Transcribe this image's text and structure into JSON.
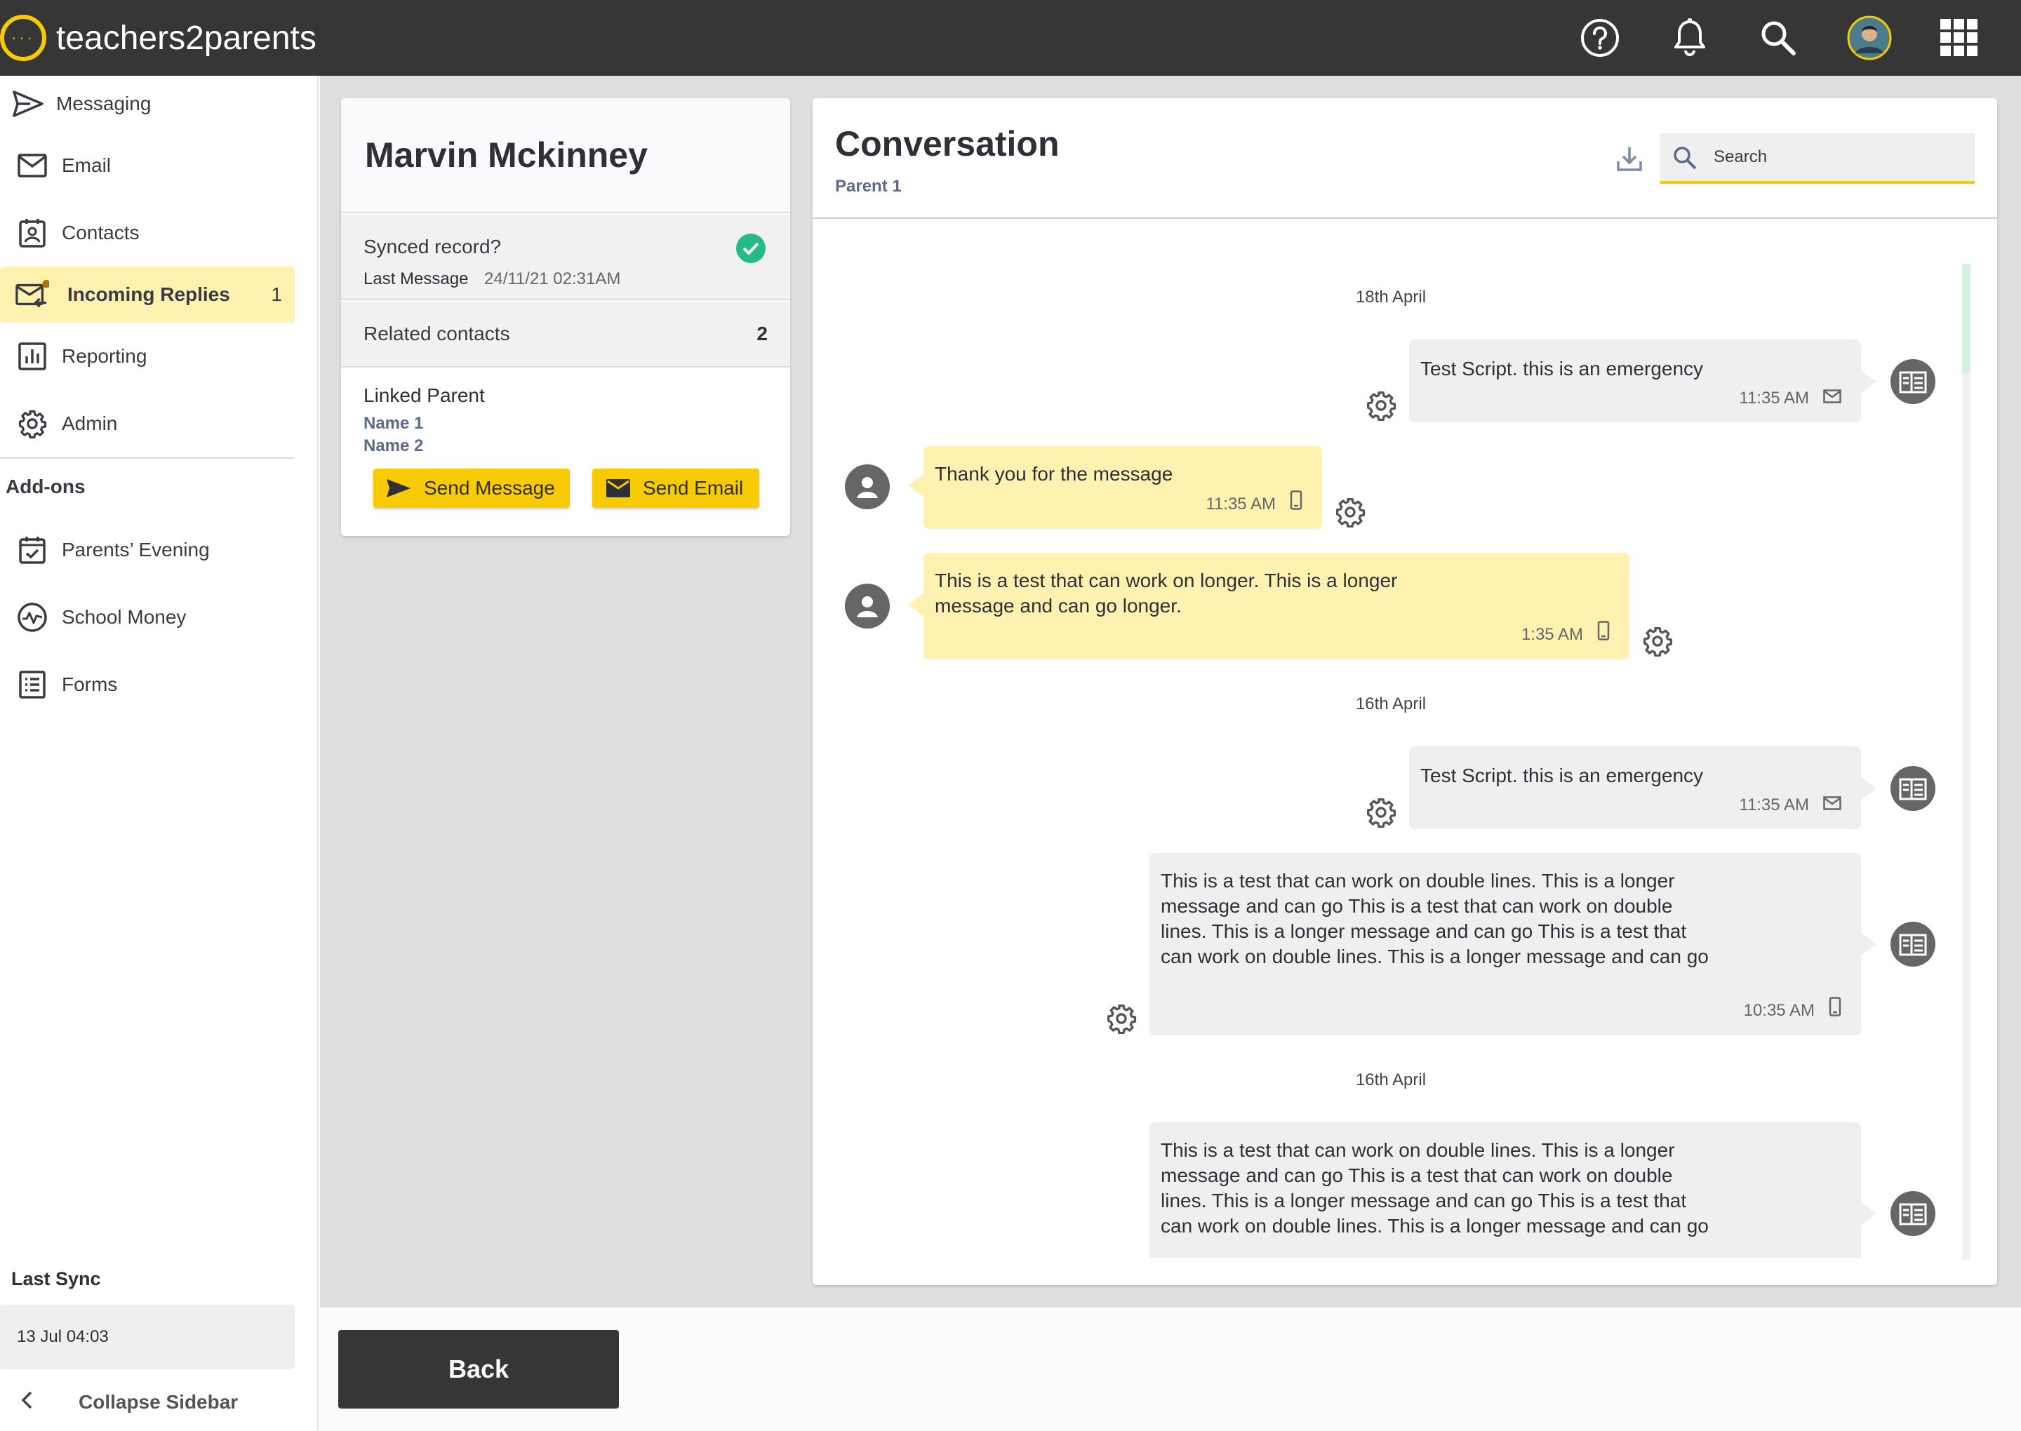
{
  "app": {
    "title": "teachers2parents"
  },
  "sidebar": {
    "items": [
      {
        "label": "Messaging"
      },
      {
        "label": "Email"
      },
      {
        "label": "Contacts"
      },
      {
        "label": "Incoming Replies",
        "count": "1"
      },
      {
        "label": "Reporting"
      },
      {
        "label": "Admin"
      }
    ],
    "addons_title": "Add-ons",
    "addons": [
      {
        "label": "Parents’ Evening"
      },
      {
        "label": "School Money"
      },
      {
        "label": "Forms"
      }
    ],
    "last_sync_label": "Last Sync",
    "last_sync_value": "13 Jul 04:03",
    "collapse_label": "Collapse Sidebar"
  },
  "contact": {
    "name": "Marvin Mckinney",
    "synced_label": "Synced record?",
    "last_message_label": "Last Message",
    "last_message_value": "24/11/21 02:31AM",
    "related_label": "Related contacts",
    "related_count": "2",
    "linked_parent_label": "Linked Parent",
    "linked_names": [
      "Name 1",
      "Name 2"
    ],
    "send_message": "Send Message",
    "send_email": "Send Email"
  },
  "conversation": {
    "title": "Conversation",
    "subtitle": "Parent 1",
    "search_placeholder": "Search",
    "dates": [
      "18th April",
      "16th April",
      "16th April"
    ],
    "messages": [
      {
        "text": "Test Script. this is an emergency",
        "time": "11:35 AM",
        "channel": "email-icon"
      },
      {
        "text": "Thank you for the message",
        "time": "11:35 AM",
        "channel": "phone-icon"
      },
      {
        "text": "This is a test that can work on longer. This is a longer message  and can go longer.",
        "time": "1:35 AM",
        "channel": "phone-icon"
      },
      {
        "text": "Test Script. this is an emergency",
        "time": "11:35 AM",
        "channel": "email-icon"
      },
      {
        "text": "This is a test that can work on double lines. This is a longer message  and can go This is a test that can work on double lines. This is a longer message  and can go This is a test that can work on double lines. This is a longer message  and can go",
        "time": "10:35 AM",
        "channel": "phone-icon"
      },
      {
        "text": "This is a test that can work on double lines. This is a longer message  and can go This is a test that can work on double lines. This is a longer message  and can go This is a test that can work on double lines. This is a longer message  and can go",
        "time": "",
        "channel": ""
      }
    ]
  },
  "footer": {
    "back_label": "Back"
  },
  "colors": {
    "accent": "#f7cb00",
    "topbar": "#363636",
    "highlight": "#fff1b0",
    "success": "#26b98a"
  }
}
